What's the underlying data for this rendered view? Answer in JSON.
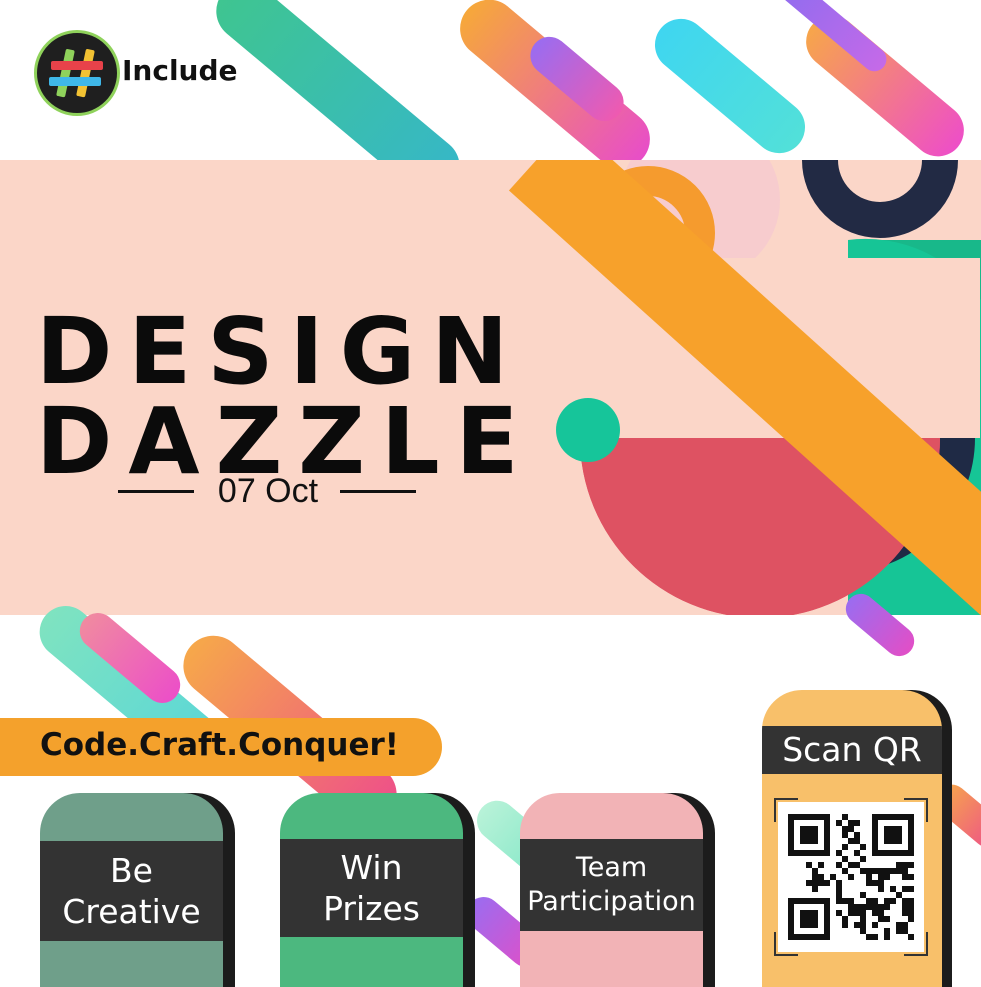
{
  "brand": {
    "name": "Include",
    "logo": "hash-logo"
  },
  "event": {
    "title_line1": "DESIGN",
    "title_line2": "DAZZLE",
    "date": "07 Oct"
  },
  "tagline": "Code.Craft.Conquer!",
  "cards": [
    {
      "line1": "Be",
      "line2": "Creative"
    },
    {
      "line1": "Win",
      "line2": "Prizes"
    },
    {
      "line1": "Team",
      "line2": "Participation"
    }
  ],
  "qr": {
    "label": "Scan QR"
  },
  "colors": {
    "banner_bg": "#fbd6c8",
    "accent_orange": "#f4a12c",
    "card_sage": "#6f9f8a",
    "card_green": "#4cb87f",
    "card_pink": "#f2b3b6",
    "qr_card": "#f8c06a",
    "band_dark": "#333333"
  }
}
